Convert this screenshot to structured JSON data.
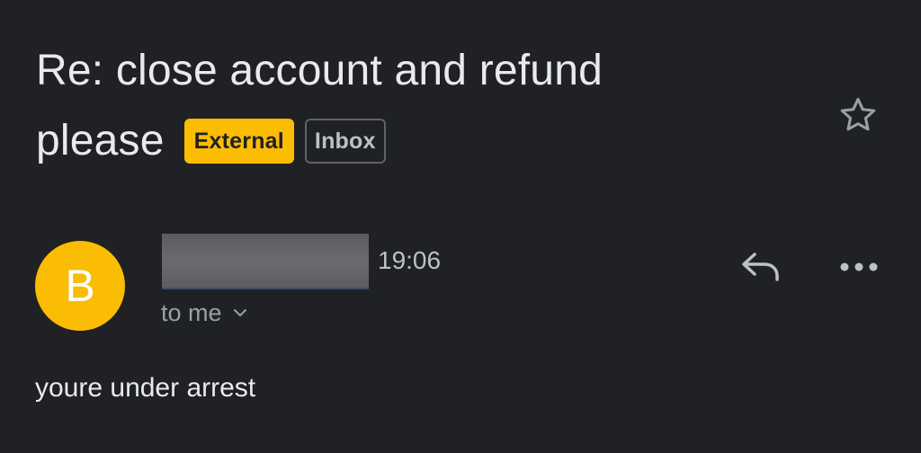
{
  "email": {
    "subject_line1": "Re: close account and refund",
    "subject_line2": "please",
    "labels": {
      "external": "External",
      "inbox": "Inbox"
    },
    "sender": {
      "avatar_letter": "B",
      "avatar_color": "#fbbc04",
      "time": "19:06",
      "recipient": "to me"
    },
    "body": "youre under arrest"
  },
  "icons": {
    "star": "star-outline-icon",
    "reply": "reply-icon",
    "more": "more-horizontal-icon",
    "chevron": "chevron-down-icon"
  },
  "colors": {
    "background": "#202124",
    "external_label": "#fbbc04",
    "text_primary": "#e8eaed",
    "text_secondary": "#9aa0a6"
  }
}
